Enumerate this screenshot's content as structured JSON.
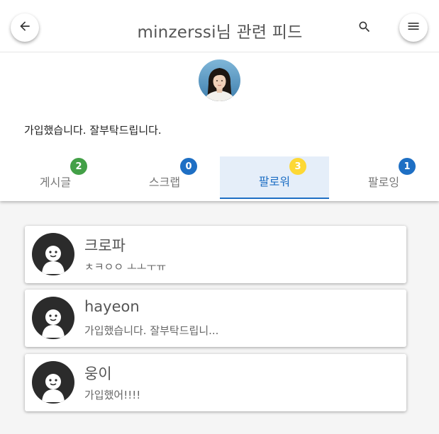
{
  "header": {
    "title": "minzerssi님 관련 피드",
    "bio": "가입했습니다. 잘부탁드립니다.",
    "icons": {
      "back": "arrow-left-icon",
      "search": "search-icon",
      "menu": "hamburger-menu-icon"
    }
  },
  "tabs": [
    {
      "label": "게시글",
      "count": "2",
      "badge_color": "#43a047",
      "active": false
    },
    {
      "label": "스크랩",
      "count": "0",
      "badge_color": "#1e6fc4",
      "active": false
    },
    {
      "label": "팔로워",
      "count": "3",
      "badge_color": "#fdd835",
      "active": true
    },
    {
      "label": "팔로잉",
      "count": "1",
      "badge_color": "#1e6fc4",
      "active": false
    }
  ],
  "followers": [
    {
      "name": "크로파",
      "message": "ㅊㅋㅇㅇ ㅗㅗㅜㅠ"
    },
    {
      "name": "hayeon",
      "message": "가입했습니다. 잘부탁드립니..."
    },
    {
      "name": "웅이",
      "message": "가입했어!!!!"
    }
  ],
  "colors": {
    "accent": "#1e6fc4",
    "active_tab_bg": "#e5eef9",
    "default_avatar": "#2b2b2b"
  }
}
